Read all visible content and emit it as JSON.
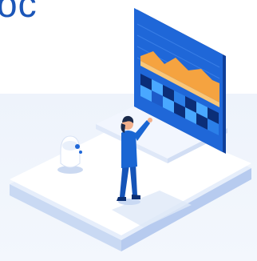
{
  "header": {
    "title_fragment": "oc"
  },
  "illustration": {
    "subject": "isometric-person-interacting-with-dashboard",
    "colors": {
      "panel_blue": "#1f67d8",
      "panel_dark": "#0f3f9a",
      "chart_orange": "#f5a340",
      "chart_light_orange": "#fbc778",
      "platform_white": "#ffffff",
      "platform_shadow": "#c9d9f3",
      "background": "#eef3fb",
      "person_blue": "#1a66d3",
      "skin": "#f2b08c"
    }
  }
}
